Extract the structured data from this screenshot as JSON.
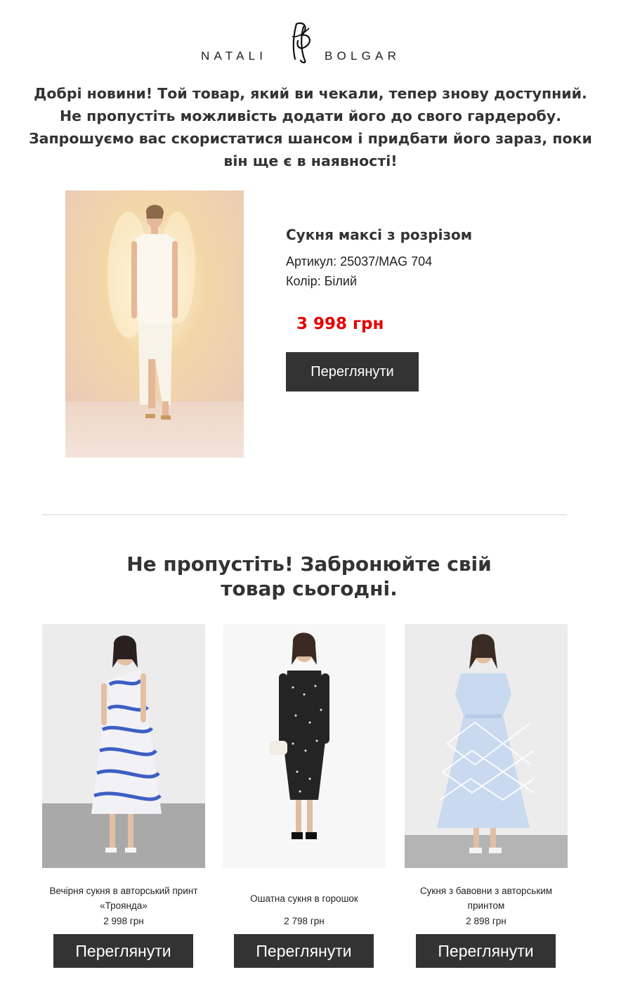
{
  "logo": {
    "left_text": "NATALI",
    "right_text": "BOLGAR",
    "monogram_icon": "nb-monogram-icon"
  },
  "intro": {
    "text": "Добрі новини! Той товар, який ви чекали, тепер знову доступний. Не пропустіть можливість додати його до свого гардеробу. Запрошуємо вас скористатися шансом і придбати його зараз, поки він ще є в наявності!"
  },
  "hero": {
    "name": "Сукня максі з розрізом",
    "sku": "Артикул: 25037/MAG 704",
    "color": "Колір: Білий",
    "price": "3 998 грн",
    "button": "Переглянути"
  },
  "recommend": {
    "title": "Не пропустіть! Забронюйте свій товар сьогодні.",
    "items": [
      {
        "name": "Вечірня сукня в авторський принт «Троянда»",
        "price": "2 998 грн",
        "button": "Переглянути"
      },
      {
        "name": "Ошатна сукня в горошок",
        "price": "2 798 грн",
        "button": "Переглянути"
      },
      {
        "name": "Сукня з бавовни з авторським принтом",
        "price": "2 898 грн",
        "button": "Переглянути"
      }
    ]
  },
  "colors": {
    "text": "#333333",
    "price_accent": "#e60000",
    "button_bg": "#333333",
    "button_text": "#ffffff"
  }
}
